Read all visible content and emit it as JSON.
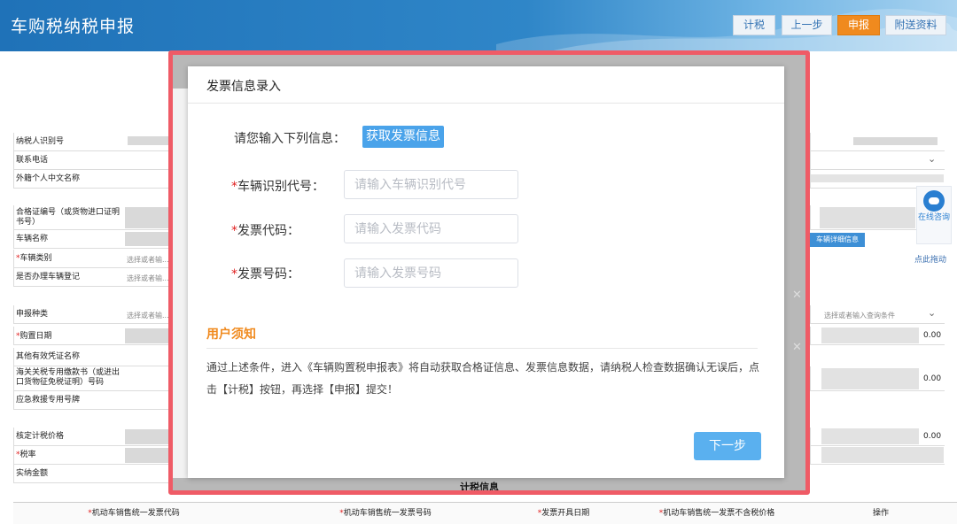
{
  "header": {
    "title": "车购税纳税申报",
    "buttons": {
      "calc": "计税",
      "prev": "上一步",
      "declare": "申报",
      "attach": "附送资料"
    }
  },
  "form": {
    "taxpayer_id": "纳税人识别号",
    "phone": "联系电话",
    "foreign_name": "外籍个人中文名称",
    "cert_no": "合格证编号（或货物进口证明书号）",
    "vehicle_name": "车辆名称",
    "vehicle_type": "车辆类别",
    "registered": "是否办理车辆登记",
    "declare_type": "申报种类",
    "purchase_date": "购置日期",
    "other_voucher": "其他有效凭证名称",
    "customs_no": "海关关税专用缴款书（或进出口货物征免税证明）号码",
    "emergency_plate": "应急救援专用号牌",
    "tax_price": "核定计税价格",
    "tax_rate": "税率",
    "actual_amount": "实纳金额",
    "hint_select": "选择或者输...",
    "hint_select_query": "选择或者输入查询条件",
    "vehicle_detail_btn": "车辆详细信息",
    "zero_value": "0.00",
    "drag_hint": "点此拖动",
    "calc_info": "计税信息",
    "table_headers": [
      "机动车销售统一发票代码",
      "机动车销售统一发票号码",
      "发票开具日期",
      "机动车销售统一发票不含税价格",
      "操作"
    ]
  },
  "chat": {
    "label": "在线咨询"
  },
  "dialog": {
    "title": "发票信息录入",
    "prompt": "请您输入下列信息：",
    "fetch_button": "获取发票信息",
    "fields": [
      {
        "label": "车辆识别代号：",
        "placeholder": "请输入车辆识别代号"
      },
      {
        "label": "发票代码：",
        "placeholder": "请输入发票代码"
      },
      {
        "label": "发票号码：",
        "placeholder": "请输入发票号码"
      }
    ],
    "notice_title": "用户须知",
    "notice_text": "通过上述条件，进入《车辆购置税申报表》将自动获取合格证信息、发票信息数据，请纳税人检查数据确认无误后，点击【计税】按钮，再选择【申报】提交！",
    "next_button": "下一步"
  },
  "colors": {
    "accent": "#4aa3ea",
    "notice": "#f08a1e",
    "highlight": "#ef5b66",
    "header": "#2f86c8"
  }
}
